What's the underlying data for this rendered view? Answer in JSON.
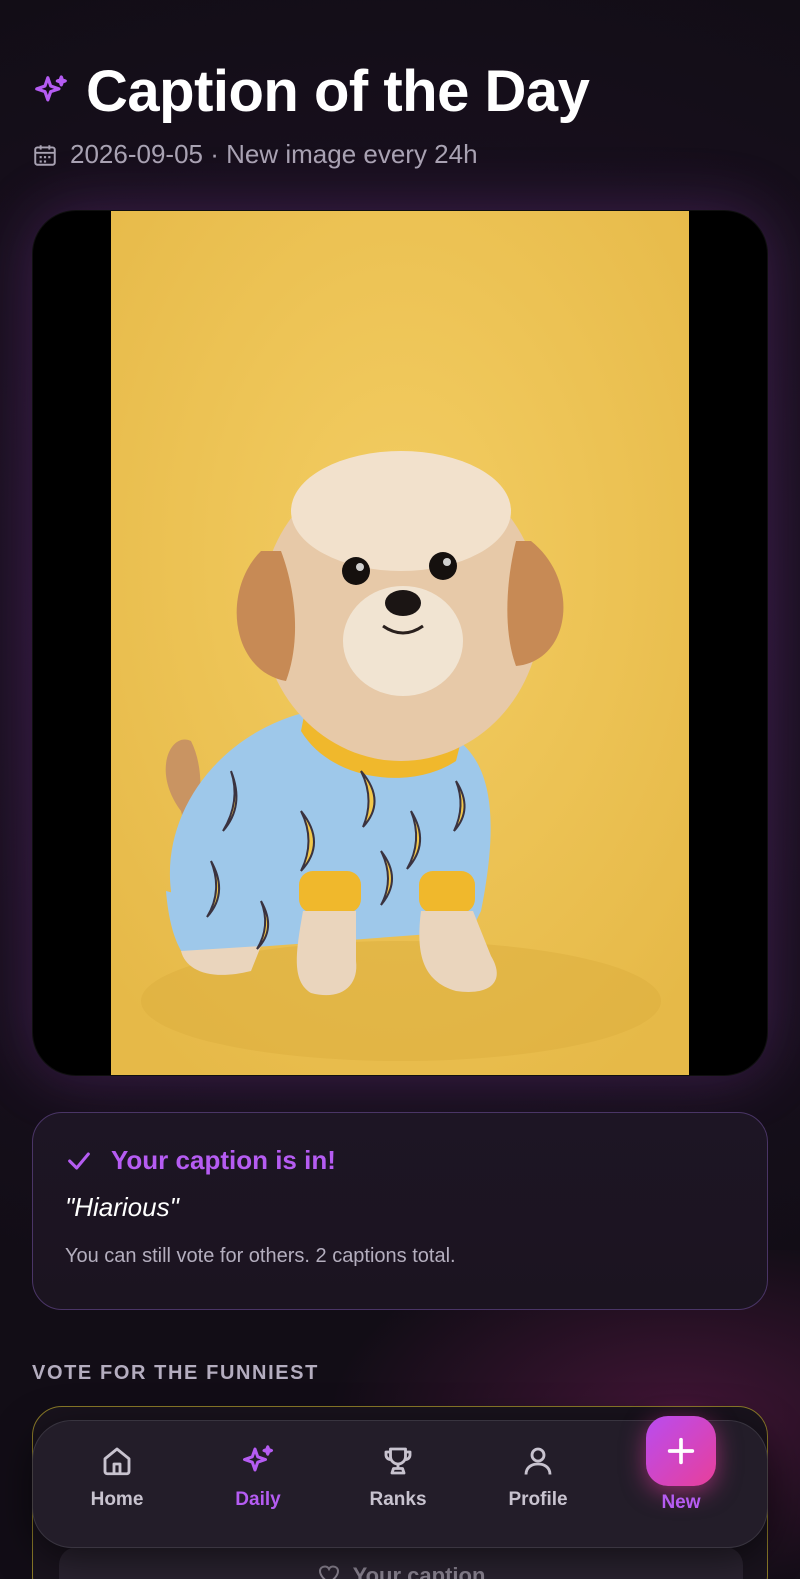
{
  "header": {
    "title": "Caption of the Day",
    "date": "2026-09-05",
    "separator": " · ",
    "cadence": "New image every 24h"
  },
  "image": {
    "subject": "Small fluffy dog wearing blue banana-print pajamas on a yellow background"
  },
  "status": {
    "title": "Your caption is in!",
    "quote": "\"Hiarious\"",
    "note": "You can still vote for others. 2 captions total."
  },
  "vote_section": {
    "label": "VOTE FOR THE FUNNIEST",
    "your_caption_label": "Your caption"
  },
  "nav": {
    "items": [
      {
        "label": "Home",
        "icon": "home-icon",
        "active": false
      },
      {
        "label": "Daily",
        "icon": "sparkles-icon",
        "active": true
      },
      {
        "label": "Ranks",
        "icon": "trophy-icon",
        "active": false
      },
      {
        "label": "Profile",
        "icon": "user-icon",
        "active": false
      }
    ],
    "new_label": "New"
  },
  "colors": {
    "accent": "#b55cf2",
    "fab_gradient_start": "#b94cf0",
    "fab_gradient_end": "#e83f9a",
    "photo_background": "#ecc04e"
  }
}
